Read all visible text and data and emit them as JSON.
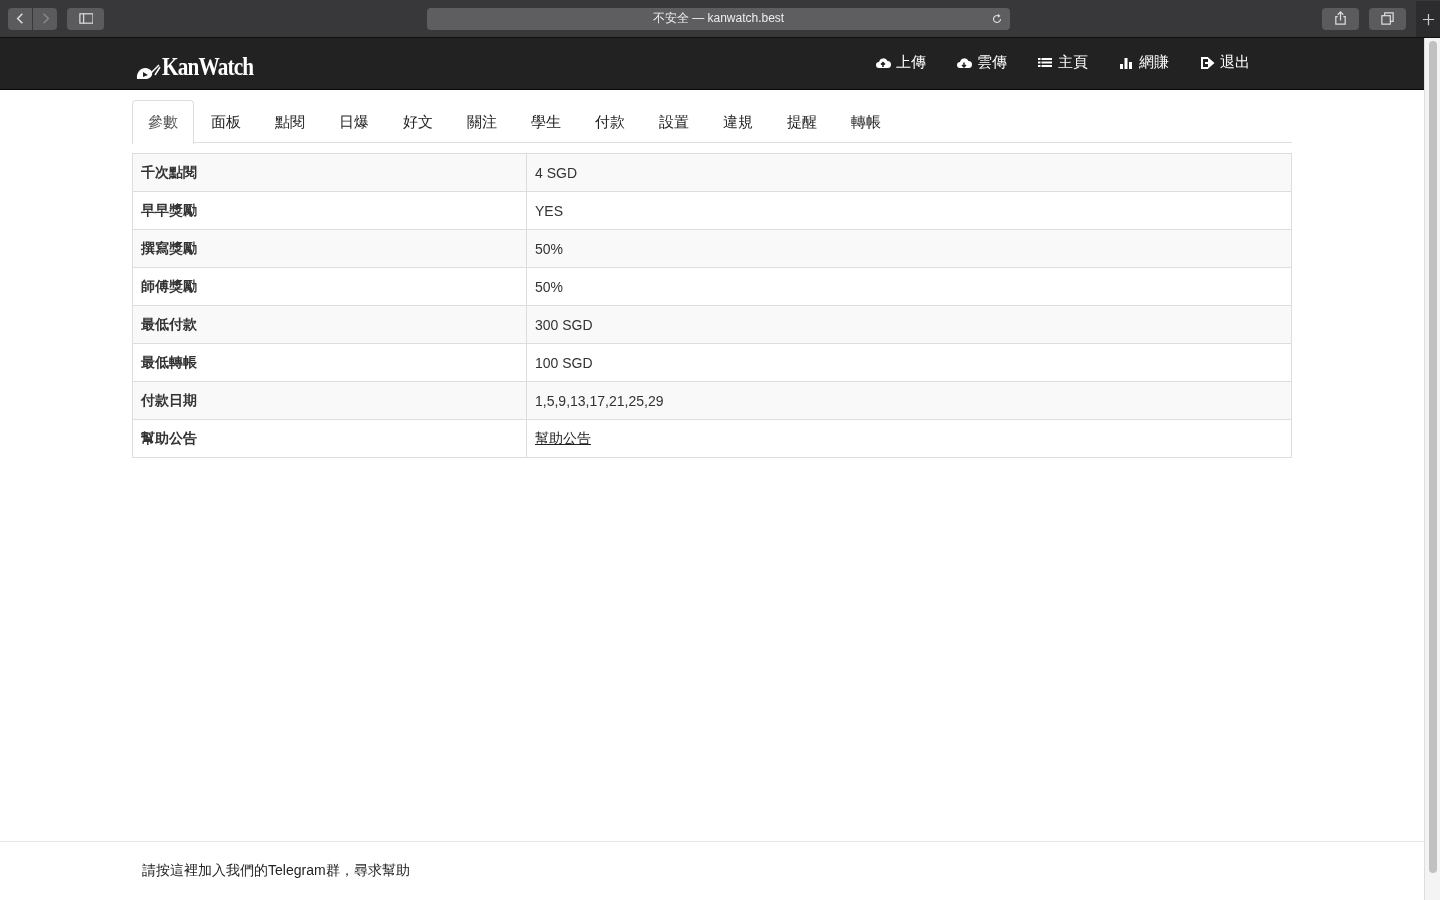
{
  "browser": {
    "address": "不安全 — kanwatch.best"
  },
  "navbar": {
    "brand": "KanWatch",
    "links": [
      {
        "kind": "upload",
        "label": "上傳"
      },
      {
        "kind": "cloud",
        "label": "雲傳"
      },
      {
        "kind": "list",
        "label": "主頁"
      },
      {
        "kind": "chart",
        "label": "網賺"
      },
      {
        "kind": "logout",
        "label": "退出"
      }
    ]
  },
  "tabs": [
    {
      "label": "參數",
      "selected": true
    },
    {
      "label": "面板",
      "selected": false
    },
    {
      "label": "點閱",
      "selected": false
    },
    {
      "label": "日爆",
      "selected": false
    },
    {
      "label": "好文",
      "selected": false
    },
    {
      "label": "關注",
      "selected": false
    },
    {
      "label": "學生",
      "selected": false
    },
    {
      "label": "付款",
      "selected": false
    },
    {
      "label": "設置",
      "selected": false
    },
    {
      "label": "違規",
      "selected": false
    },
    {
      "label": "提醒",
      "selected": false
    },
    {
      "label": "轉帳",
      "selected": false
    }
  ],
  "table": {
    "rows": [
      {
        "label": "千次點閱",
        "value": "4 SGD"
      },
      {
        "label": "早早獎勵",
        "value": "YES"
      },
      {
        "label": "撰寫獎勵",
        "value": "50%"
      },
      {
        "label": "師傅獎勵",
        "value": "50%"
      },
      {
        "label": "最低付款",
        "value": "300 SGD"
      },
      {
        "label": "最低轉帳",
        "value": "100 SGD"
      },
      {
        "label": "付款日期",
        "value": "1,5,9,13,17,21,25,29"
      },
      {
        "label": "幫助公告",
        "value": "幫助公告",
        "kind": "link"
      }
    ]
  },
  "footer": {
    "text": "請按這裡加入我們的Telegram群，尋求幫助"
  }
}
